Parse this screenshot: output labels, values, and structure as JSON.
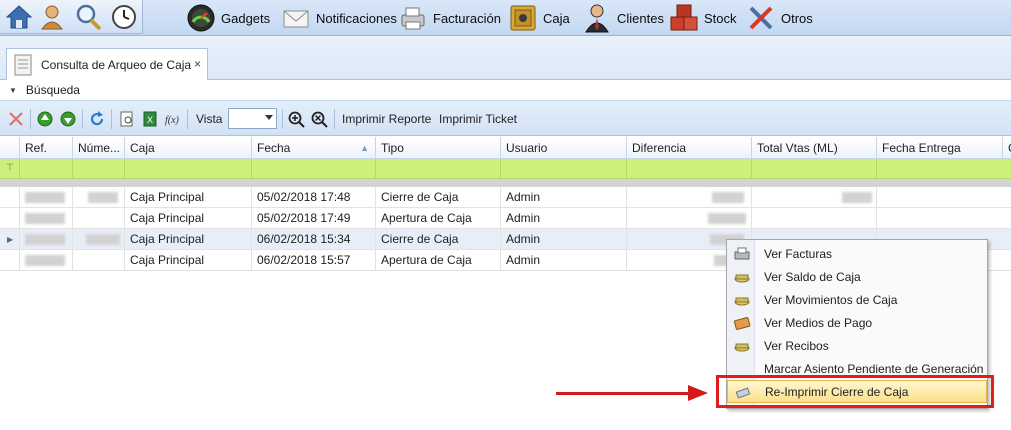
{
  "ribbon": {
    "quick_icons": [
      "home-icon",
      "user-icon",
      "search-icon",
      "clock-icon"
    ],
    "menu": [
      {
        "label": "Gadgets",
        "icon": "gauge-icon"
      },
      {
        "label": "Notificaciones",
        "icon": "envelope-icon"
      },
      {
        "label": "Facturación",
        "icon": "printer-icon"
      },
      {
        "label": "Caja",
        "icon": "safe-icon"
      },
      {
        "label": "Clientes",
        "icon": "person-icon"
      },
      {
        "label": "Stock",
        "icon": "boxes-icon"
      },
      {
        "label": "Otros",
        "icon": "tools-icon"
      }
    ]
  },
  "tab": {
    "title": "Consulta de Arqueo de Caja",
    "close": "×"
  },
  "search": {
    "label": "Búsqueda"
  },
  "toolbar": {
    "vista_label": "Vista",
    "vista_value": "",
    "print_report": "Imprimir Reporte",
    "print_ticket": "Imprimir Ticket"
  },
  "grid": {
    "columns": [
      "Ref.",
      "Núme...",
      "Caja",
      "Fecha",
      "Tipo",
      "Usuario",
      "Diferencia",
      "Total Vtas (ML)",
      "Fecha Entrega",
      "C"
    ],
    "sorted_column": "Fecha",
    "rows": [
      {
        "caja": "Caja Principal",
        "fecha": "05/02/2018 17:48",
        "tipo": "Cierre de Caja",
        "usuario": "Admin"
      },
      {
        "caja": "Caja Principal",
        "fecha": "05/02/2018 17:49",
        "tipo": "Apertura de Caja",
        "usuario": "Admin"
      },
      {
        "caja": "Caja Principal",
        "fecha": "06/02/2018 15:34",
        "tipo": "Cierre de Caja",
        "usuario": "Admin"
      },
      {
        "caja": "Caja Principal",
        "fecha": "06/02/2018 15:57",
        "tipo": "Apertura de Caja",
        "usuario": "Admin"
      }
    ]
  },
  "context_menu": {
    "items": [
      {
        "label": "Ver Facturas",
        "icon": "printer-icon"
      },
      {
        "label": "Ver Saldo de Caja",
        "icon": "cash-icon"
      },
      {
        "label": "Ver Movimientos de Caja",
        "icon": "cash-icon"
      },
      {
        "label": "Ver Medios de Pago",
        "icon": "payment-icon"
      },
      {
        "label": "Ver Recibos",
        "icon": "cash-icon"
      },
      {
        "label": "Marcar Asiento Pendiente de Generación",
        "icon": ""
      },
      {
        "label": "Re-Imprimir Cierre de Caja",
        "icon": "reprint-icon",
        "highlighted": true
      }
    ]
  },
  "colors": {
    "highlight": "#e11c1c",
    "filter_row": "#cdf07a"
  }
}
